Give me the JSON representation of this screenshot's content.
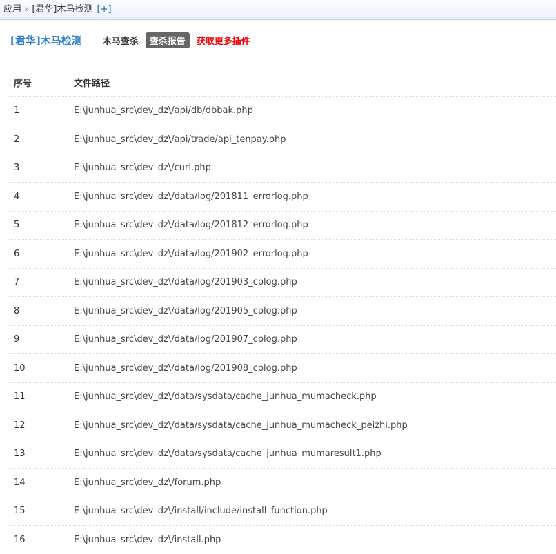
{
  "breadcrumb": {
    "root": "应用",
    "separator": "»",
    "current": "[君华]木马检测",
    "add_link": "[+]"
  },
  "header": {
    "plugin_title": "[君华]木马检测",
    "tabs": [
      {
        "label": "木马查杀",
        "active": false
      },
      {
        "label": "查杀报告",
        "active": true
      }
    ],
    "more_plugins_link": "获取更多插件"
  },
  "table": {
    "columns": [
      "序号",
      "文件路径"
    ],
    "rows": [
      {
        "no": "1",
        "path": "E:\\junhua_src\\dev_dz\\/api/db/dbbak.php"
      },
      {
        "no": "2",
        "path": "E:\\junhua_src\\dev_dz\\/api/trade/api_tenpay.php"
      },
      {
        "no": "3",
        "path": "E:\\junhua_src\\dev_dz\\/curl.php"
      },
      {
        "no": "4",
        "path": "E:\\junhua_src\\dev_dz\\/data/log/201811_errorlog.php"
      },
      {
        "no": "5",
        "path": "E:\\junhua_src\\dev_dz\\/data/log/201812_errorlog.php"
      },
      {
        "no": "6",
        "path": "E:\\junhua_src\\dev_dz\\/data/log/201902_errorlog.php"
      },
      {
        "no": "7",
        "path": "E:\\junhua_src\\dev_dz\\/data/log/201903_cplog.php"
      },
      {
        "no": "8",
        "path": "E:\\junhua_src\\dev_dz\\/data/log/201905_cplog.php"
      },
      {
        "no": "9",
        "path": "E:\\junhua_src\\dev_dz\\/data/log/201907_cplog.php"
      },
      {
        "no": "10",
        "path": "E:\\junhua_src\\dev_dz\\/data/log/201908_cplog.php"
      },
      {
        "no": "11",
        "path": "E:\\junhua_src\\dev_dz\\/data/sysdata/cache_junhua_mumacheck.php"
      },
      {
        "no": "12",
        "path": "E:\\junhua_src\\dev_dz\\/data/sysdata/cache_junhua_mumacheck_peizhi.php"
      },
      {
        "no": "13",
        "path": "E:\\junhua_src\\dev_dz\\/data/sysdata/cache_junhua_mumaresult1.php"
      },
      {
        "no": "14",
        "path": "E:\\junhua_src\\dev_dz\\/forum.php"
      },
      {
        "no": "15",
        "path": "E:\\junhua_src\\dev_dz\\/install/include/install_function.php"
      },
      {
        "no": "16",
        "path": "E:\\junhua_src\\dev_dz\\/install.php"
      }
    ]
  },
  "colors": {
    "title_blue": "#2b7ec2",
    "active_tab_bg": "#666666",
    "red_link": "#ee0000"
  }
}
